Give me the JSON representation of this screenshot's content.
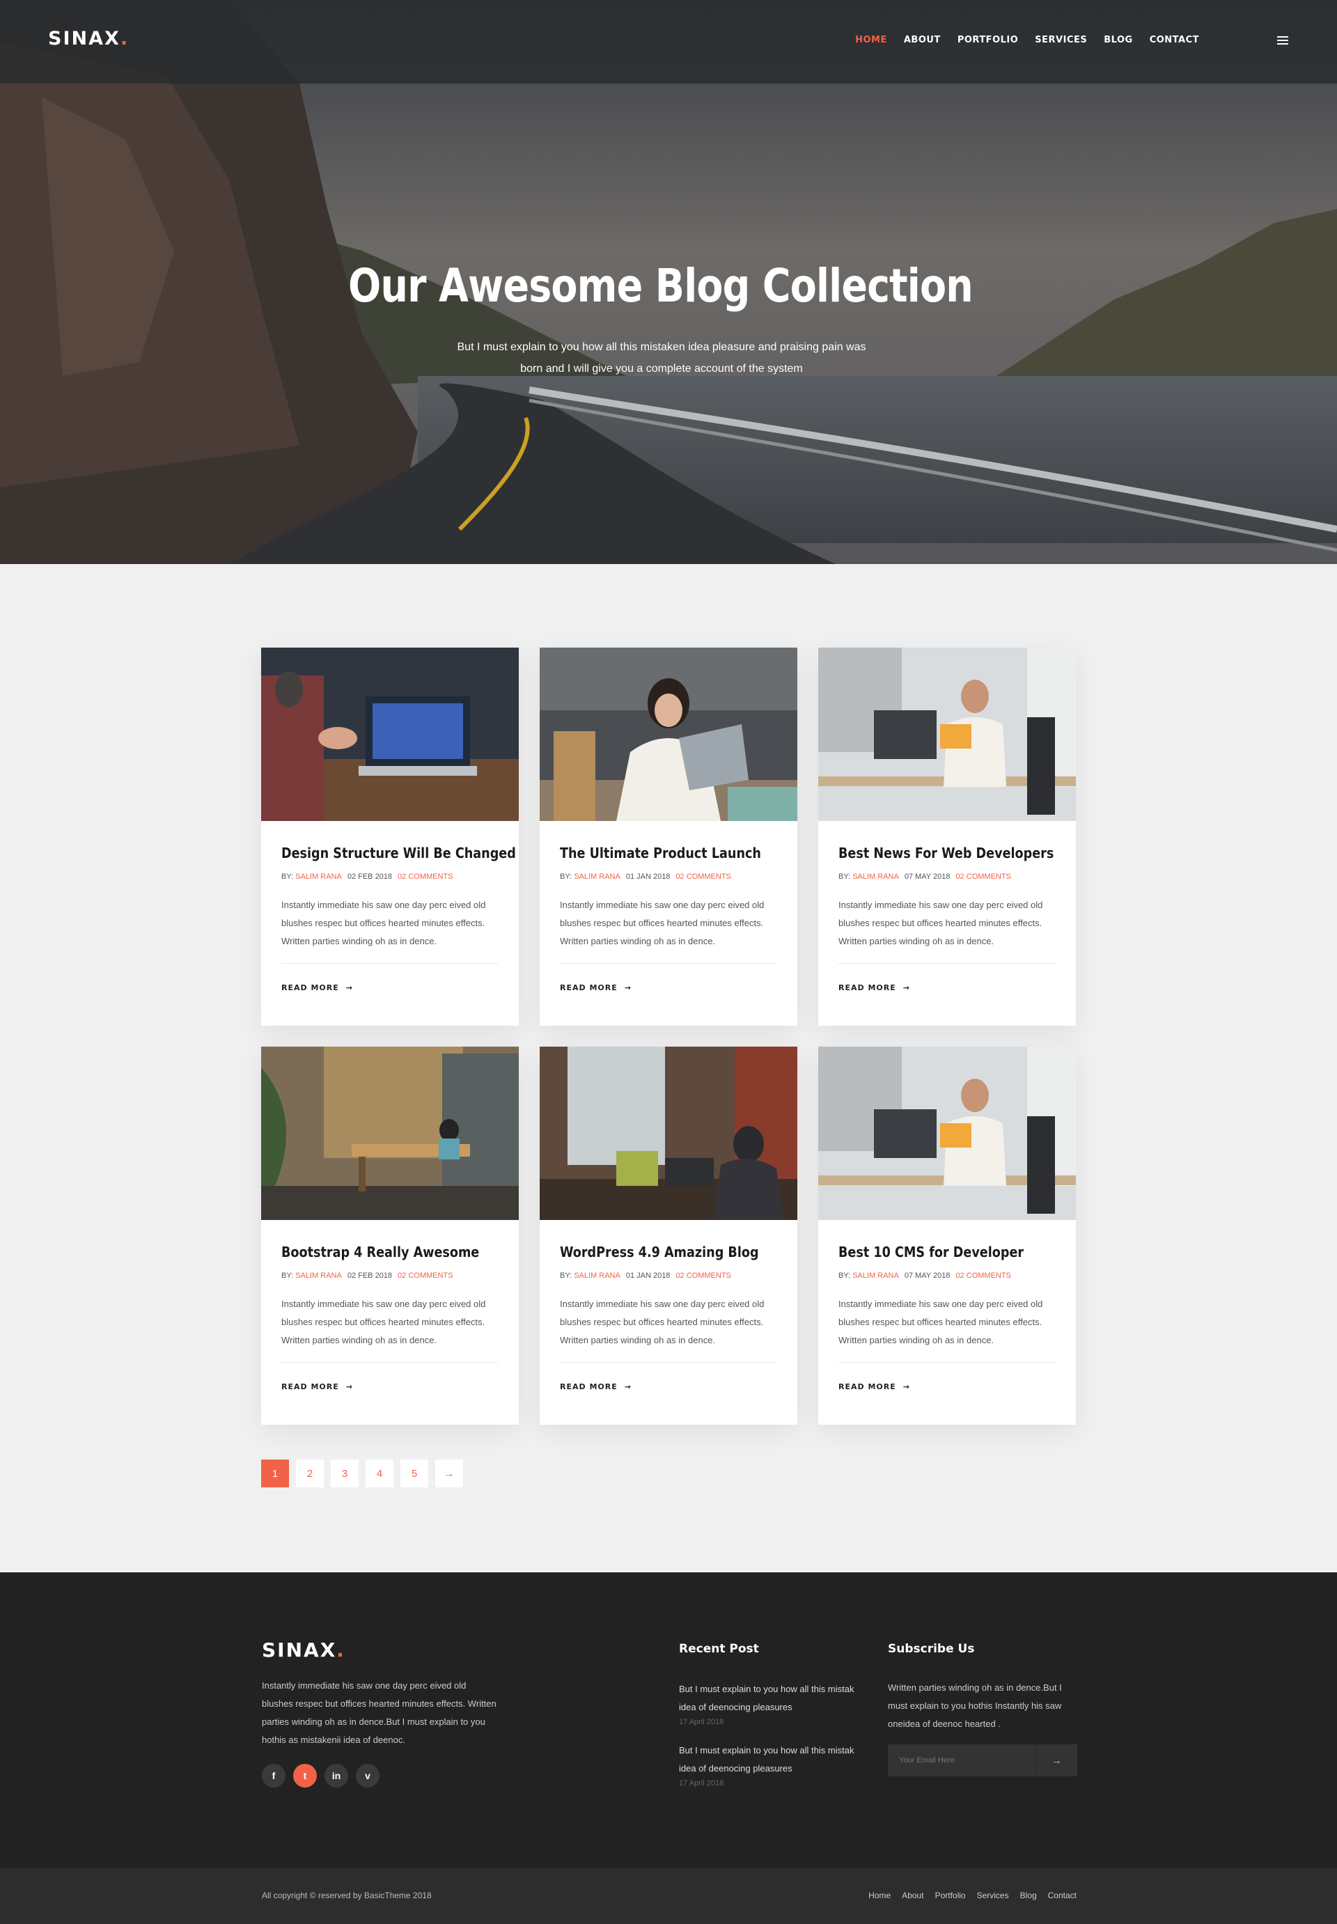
{
  "brand": {
    "name": "SINAX",
    "dot": ".",
    "accent": "#f26249"
  },
  "nav": [
    {
      "label": "HOME",
      "active": true
    },
    {
      "label": "ABOUT"
    },
    {
      "label": "PORTFOLIO"
    },
    {
      "label": "SERVICES"
    },
    {
      "label": "BLOG"
    },
    {
      "label": "CONTACT"
    }
  ],
  "hero": {
    "title": "Our Awesome Blog Collection",
    "subtitle": "But I must explain to you how all this mistaken idea pleasure and praising pain was born and I will give you a complete account of the system"
  },
  "posts": [
    {
      "title": "Design Structure Will Be Changed",
      "by": "BY:",
      "author": "SALIM RANA",
      "date": "02 FEB 2018",
      "comments": "02 COMMENTS",
      "excerpt": "Instantly immediate his saw one day perc eived old blushes respec but offices hearted minutes effects. Written parties winding oh as in dence.",
      "read_more": "READ MORE"
    },
    {
      "title": "The Ultimate Product Launch",
      "by": "BY:",
      "author": "SALIM RANA",
      "date": "01 JAN 2018",
      "comments": "02 COMMENTS",
      "excerpt": "Instantly immediate his saw one day perc eived old blushes respec but offices hearted minutes effects. Written parties winding oh as in dence.",
      "read_more": "READ MORE"
    },
    {
      "title": "Best News For Web Developers",
      "by": "BY:",
      "author": "SALIM RANA",
      "date": "07 MAY 2018",
      "comments": "02 COMMENTS",
      "excerpt": "Instantly immediate his saw one day perc eived old blushes respec but offices hearted minutes effects. Written parties winding oh as in dence.",
      "read_more": "READ MORE"
    },
    {
      "title": "Bootstrap 4 Really Awesome",
      "by": "BY:",
      "author": "SALIM RANA",
      "date": "02 FEB 2018",
      "comments": "02 COMMENTS",
      "excerpt": "Instantly immediate his saw one day perc eived old blushes respec but offices hearted minutes effects. Written parties winding oh as in dence.",
      "read_more": "READ MORE"
    },
    {
      "title": "WordPress 4.9 Amazing Blog",
      "by": "BY:",
      "author": "SALIM RANA",
      "date": "01 JAN 2018",
      "comments": "02 COMMENTS",
      "excerpt": "Instantly immediate his saw one day perc eived old blushes respec but offices hearted minutes effects. Written parties winding oh as in dence.",
      "read_more": "READ MORE"
    },
    {
      "title": "Best 10 CMS for Developer",
      "by": "BY:",
      "author": "SALIM RANA",
      "date": "07 MAY 2018",
      "comments": "02 COMMENTS",
      "excerpt": "Instantly immediate his saw one day perc eived old blushes respec but offices hearted minutes effects. Written parties winding oh as in dence.",
      "read_more": "READ MORE"
    }
  ],
  "pagination": {
    "pages": [
      "1",
      "2",
      "3",
      "4",
      "5"
    ],
    "current": "1",
    "next_icon": "arrow-right-icon"
  },
  "footer": {
    "about": "Instantly immediate his saw one day perc eived old blushes respec but offices hearted minutes effects. Written parties winding oh as in dence.But I must explain to you hothis as mistakenii idea of deenoc.",
    "socials": [
      {
        "icon": "facebook-icon",
        "glyph": "f"
      },
      {
        "icon": "twitter-icon",
        "glyph": "t",
        "active": true
      },
      {
        "icon": "linkedin-icon",
        "glyph": "in"
      },
      {
        "icon": "vimeo-icon",
        "glyph": "v"
      }
    ],
    "recent_title": "Recent Post",
    "recent": [
      {
        "title": "But I must explain to you how all this mistak idea of deenocing pleasures",
        "date": "17 April 2018"
      },
      {
        "title": "But I must explain to you how all this mistak idea of deenocing pleasures",
        "date": "17 April 2018"
      }
    ],
    "subscribe_title": "Subscribe Us",
    "subscribe_text": "Written parties winding oh as in dence.But I must explain to you hothis Instantly his saw oneidea of deenoc hearted .",
    "email_placeholder": "Your Email Here",
    "copyright": "All copyright © reserved by BasicTheme 2018",
    "links": [
      "Home",
      "About",
      "Portfolio",
      "Services",
      "Blog",
      "Contact"
    ]
  }
}
